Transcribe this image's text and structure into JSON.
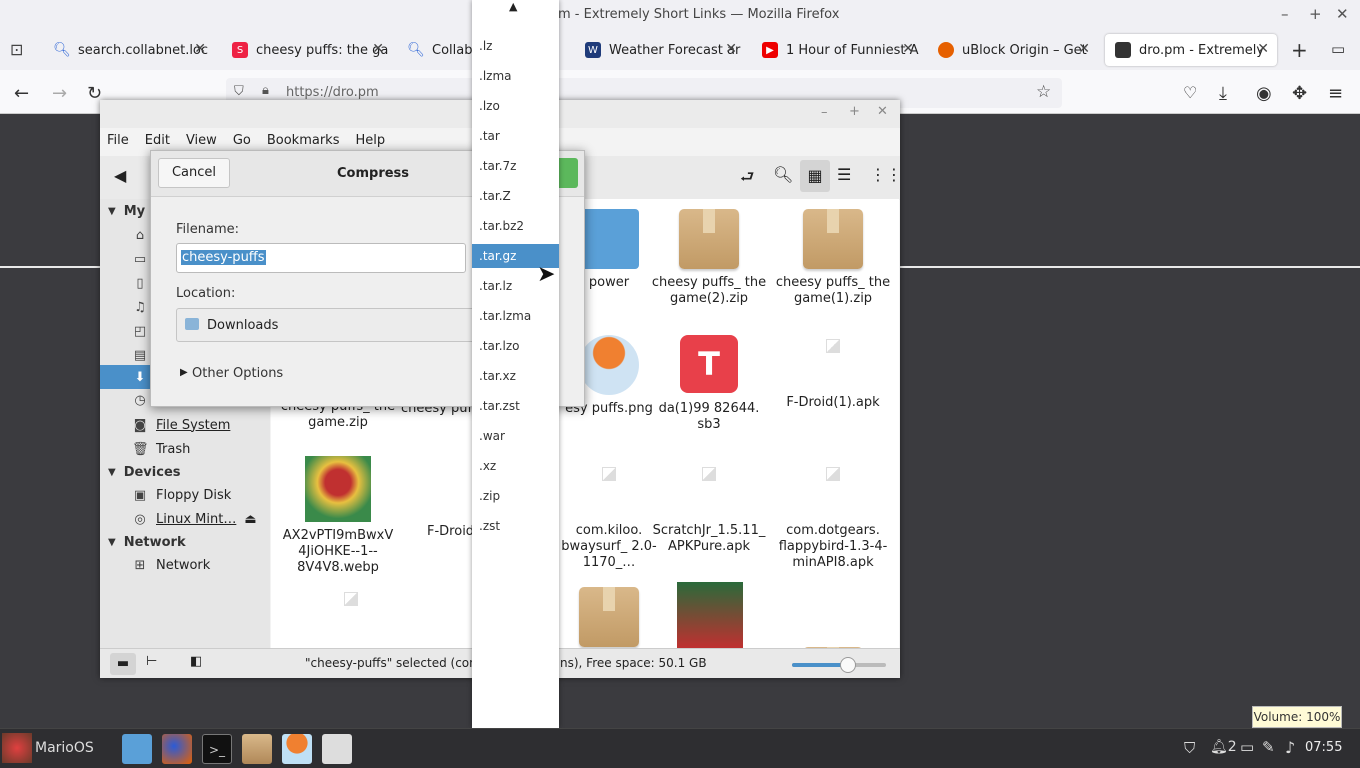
{
  "firefox": {
    "window_title": "dro.pm - Extremely Short Links — Mozilla Firefox",
    "window_title_visible": "m - Extremely Short Links — Mozilla Firefox",
    "tabs": [
      {
        "label": "search.collabnet.loc",
        "icon": "search-icon"
      },
      {
        "label": "cheesy puffs: the ga",
        "icon": "scratch-icon"
      },
      {
        "label": "CollabN",
        "icon": "search-icon"
      },
      {
        "label": "Weather Forecast ar",
        "icon": "weather-icon"
      },
      {
        "label": "1 Hour of Funniest A",
        "icon": "youtube-icon"
      },
      {
        "label": "uBlock Origin – Get",
        "icon": "firefox-addon-icon"
      },
      {
        "label": "dro.pm - Extremely",
        "icon": "dropm-icon"
      }
    ],
    "url": "https://dro.pm"
  },
  "file_manager": {
    "menu": [
      "File",
      "Edit",
      "View",
      "Go",
      "Bookmarks",
      "Help"
    ],
    "sidebar": {
      "my_computer_header": "My",
      "items_visible": [
        {
          "label": "File System",
          "icon": "filesystem-icon"
        },
        {
          "label": "Trash",
          "icon": "trash-icon"
        }
      ],
      "devices_header": "Devices",
      "devices": [
        {
          "label": "Floppy Disk",
          "icon": "floppy-icon"
        },
        {
          "label": "Linux Mint…",
          "icon": "disc-icon"
        }
      ],
      "network_header": "Network",
      "network": [
        {
          "label": "Network",
          "icon": "network-icon"
        }
      ]
    },
    "files": [
      {
        "name": "power"
      },
      {
        "name": "cheesy puffs_ the game(2).zip"
      },
      {
        "name": "cheesy puffs_ the game(1).zip"
      },
      {
        "name": "cheesy puffs_ the game.zip"
      },
      {
        "name": "cheesy puf"
      },
      {
        "name": "esy puffs.png"
      },
      {
        "name": "da(1)99 82644. sb3"
      },
      {
        "name": "F-Droid(1).apk"
      },
      {
        "name": "AX2vPTI9mBwxV 4JiOHKE--1-- 8V4V8.webp"
      },
      {
        "name": "F-Droid"
      },
      {
        "name": "com.kiloo. bwaysurf_ 2.0-1170_…"
      },
      {
        "name": "ScratchJr_1.5.11_ APKPure.apk"
      },
      {
        "name": "com.dotgears. flappybird-1.3-4- minAPI8.apk"
      }
    ],
    "status": "\"cheesy-puffs\" selected (con",
    "status_tail": "ns), Free space: 50.1 GB",
    "zoom_level": 0.6
  },
  "compress_dialog": {
    "title": "Compress",
    "cancel_label": "Cancel",
    "filename_label": "Filename:",
    "filename_value": "cheesy-puffs",
    "location_label": "Location:",
    "location_value": "Downloads",
    "other_options_label": "Other Options"
  },
  "format_dropdown": {
    "options": [
      ".lz",
      ".lzma",
      ".lzo",
      ".tar",
      ".tar.7z",
      ".tar.Z",
      ".tar.bz2",
      ".tar.gz",
      ".tar.lz",
      ".tar.lzma",
      ".tar.lzo",
      ".tar.xz",
      ".tar.zst",
      ".war",
      ".xz",
      ".zip",
      ".zst"
    ],
    "selected": ".tar.gz"
  },
  "taskbar": {
    "menu_label": "MarioOS",
    "clock": "07:55",
    "volume_tooltip": "Volume: 100%",
    "notification_count": "2"
  },
  "colors": {
    "selection": "#4a90c9",
    "accent_green": "#5cb85c"
  }
}
